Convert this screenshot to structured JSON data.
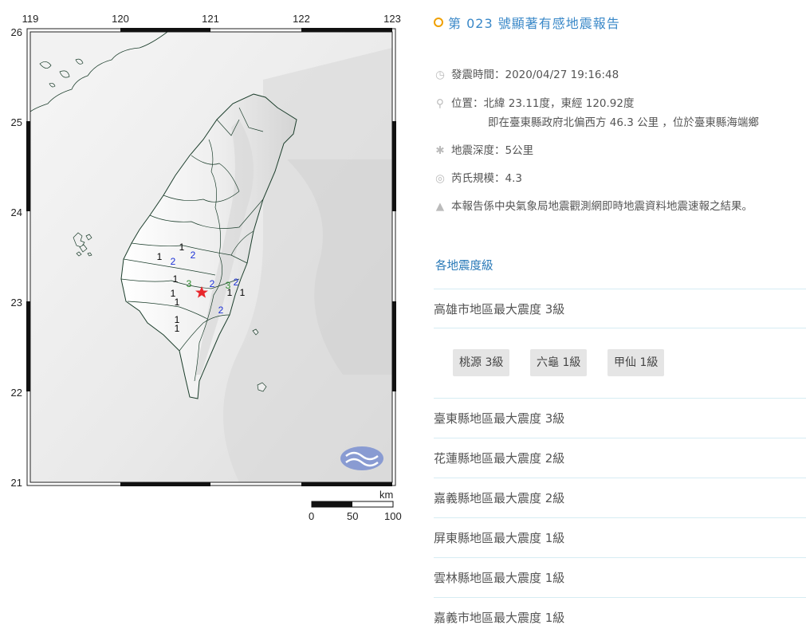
{
  "map": {
    "x_ticks": [
      "119",
      "120",
      "121",
      "122",
      "123"
    ],
    "y_ticks": [
      "26",
      "25",
      "24",
      "23",
      "22",
      "21"
    ],
    "scale": {
      "unit": "km",
      "labels": [
        "0",
        "50",
        "100"
      ]
    },
    "intensity_markers": [
      {
        "value": "1",
        "color": "#000000"
      },
      {
        "value": "1",
        "color": "#000000"
      },
      {
        "value": "1",
        "color": "#000000"
      },
      {
        "value": "1",
        "color": "#000000"
      },
      {
        "value": "1",
        "color": "#000000"
      },
      {
        "value": "1",
        "color": "#000000"
      },
      {
        "value": "1",
        "color": "#000000"
      },
      {
        "value": "1",
        "color": "#000000"
      },
      {
        "value": "1",
        "color": "#000000"
      },
      {
        "value": "2",
        "color": "#1a2fd6"
      },
      {
        "value": "2",
        "color": "#1a2fd6"
      },
      {
        "value": "2",
        "color": "#1a2fd6"
      },
      {
        "value": "2",
        "color": "#1a2fd6"
      },
      {
        "value": "2",
        "color": "#1a2fd6"
      },
      {
        "value": "3",
        "color": "#2e8b2e"
      },
      {
        "value": "3",
        "color": "#2e8b2e"
      }
    ],
    "epicenter_color": "#e8262b"
  },
  "report": {
    "title": "第 023 號顯著有感地震報告",
    "time": "發震時間：2020/04/27 19:16:48",
    "location": "位置：北緯 23.11度，東經 120.92度",
    "location_detail": "即在臺東縣政府北偏西方 46.3 公里 ，位於臺東縣海端鄉",
    "depth": "地震深度：5公里",
    "magnitude": "芮氏規模：4.3",
    "note": "本報告係中央氣象局地震觀測網即時地震資料地震速報之結果。",
    "icons": [
      "clock-icon",
      "location-pin-icon",
      "depth-icon",
      "magnitude-icon",
      "megaphone-icon"
    ],
    "accent_color": "#3a88c8"
  },
  "intensity_section": {
    "title": "各地震度級",
    "regions": [
      {
        "label": "高雄市地區最大震度 3級"
      },
      {
        "label": "臺東縣地區最大震度 3級"
      },
      {
        "label": "花蓮縣地區最大震度 2級"
      },
      {
        "label": "嘉義縣地區最大震度 2級"
      },
      {
        "label": "屏東縣地區最大震度 1級"
      },
      {
        "label": "雲林縣地區最大震度 1級"
      },
      {
        "label": "嘉義市地區最大震度 1級"
      }
    ],
    "stations": [
      "桃源 3級",
      "六龜 1級",
      "甲仙 1級"
    ]
  }
}
